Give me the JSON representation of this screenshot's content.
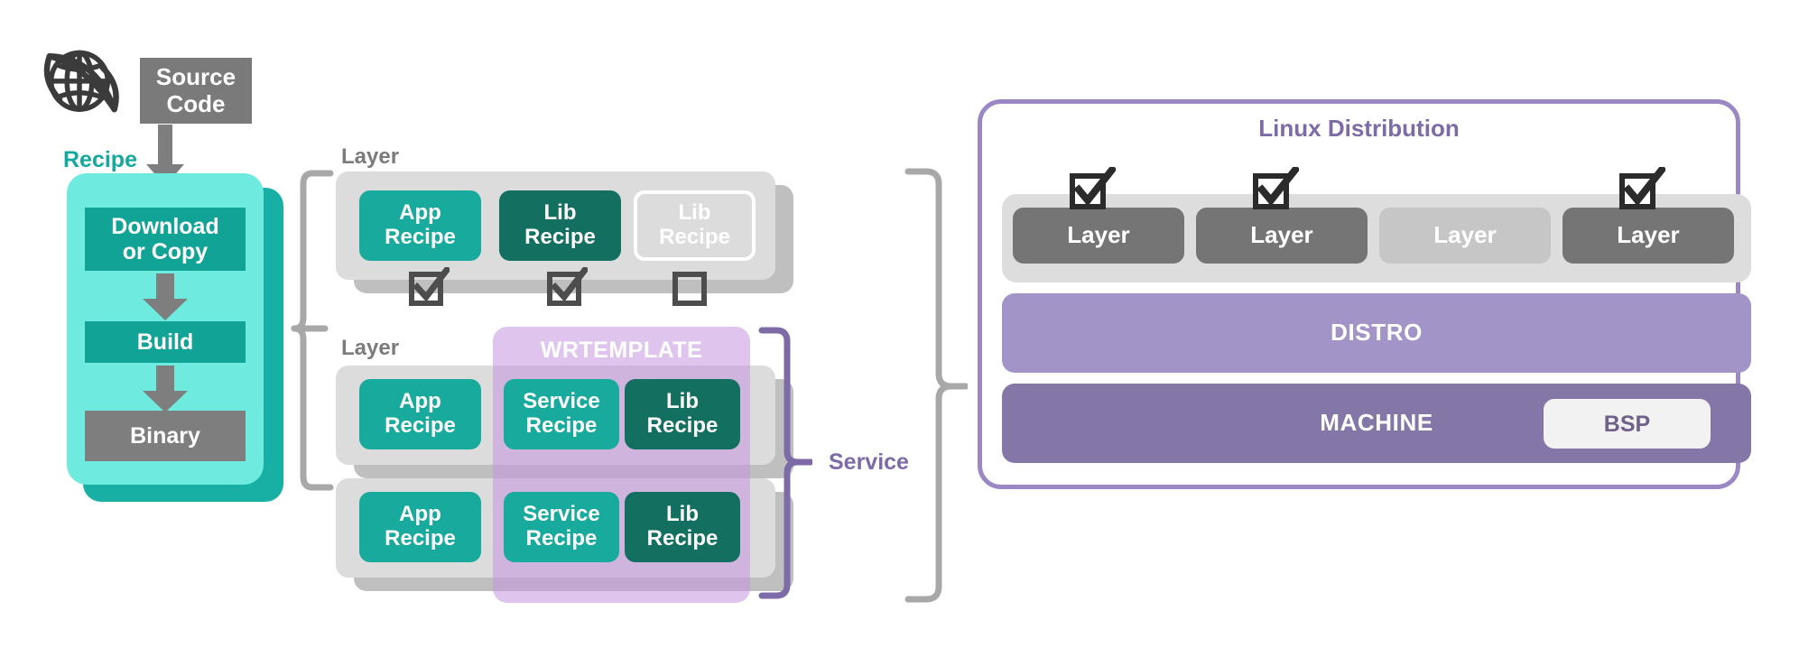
{
  "source": {
    "globe_icon": "globe-icon",
    "title": "Source\nCode",
    "title_line1": "Source",
    "title_line2": "Code"
  },
  "recipe": {
    "label": "Recipe",
    "steps": [
      {
        "label": "Download\nor Copy",
        "line1": "Download",
        "line2": "or Copy",
        "style": "teal"
      },
      {
        "label": "Build",
        "line1": "Build",
        "line2": "",
        "style": "teal"
      },
      {
        "label": "Binary",
        "line1": "Binary",
        "line2": "",
        "style": "gray"
      }
    ],
    "colors": {
      "card": "#6eeade",
      "shadow": "#18b0a4",
      "step": "#12a397",
      "step_gray": "#7e7e7e",
      "label": "#13a99d"
    }
  },
  "layers": {
    "label": "Layer",
    "group_top": {
      "label": "Layer",
      "recipes": [
        {
          "line1": "App",
          "line2": "Recipe",
          "kind": "app",
          "checkbox": "checked"
        },
        {
          "line1": "Lib",
          "line2": "Recipe",
          "kind": "lib",
          "checkbox": "checked"
        },
        {
          "line1": "Lib",
          "line2": "Recipe",
          "kind": "ghost",
          "checkbox": "unchecked"
        }
      ]
    },
    "group_mid": {
      "label": "Layer",
      "recipes": [
        {
          "line1": "App",
          "line2": "Recipe",
          "kind": "app"
        },
        {
          "line1": "Service",
          "line2": "Recipe",
          "kind": "svc"
        },
        {
          "line1": "Lib",
          "line2": "Recipe",
          "kind": "lib"
        }
      ]
    },
    "group_bottom": {
      "label": "",
      "recipes": [
        {
          "line1": "App",
          "line2": "Recipe",
          "kind": "app"
        },
        {
          "line1": "Service",
          "line2": "Recipe",
          "kind": "svc"
        },
        {
          "line1": "Lib",
          "line2": "Recipe",
          "kind": "lib"
        }
      ]
    }
  },
  "wrtemplate": {
    "title": "WRTEMPLATE",
    "color": "#c496de"
  },
  "service_bracket": {
    "label": "Service",
    "color": "#7d6ba8"
  },
  "distribution": {
    "title": "Linux Distribution",
    "border_color": "#9b87c4",
    "layer_row": [
      {
        "label": "Layer",
        "state": "on",
        "checkbox": "checked"
      },
      {
        "label": "Layer",
        "state": "on",
        "checkbox": "checked"
      },
      {
        "label": "Layer",
        "state": "off",
        "checkbox": "none"
      },
      {
        "label": "Layer",
        "state": "on",
        "checkbox": "checked"
      }
    ],
    "distro_bar": {
      "label": "DISTRO",
      "color": "#a294c6"
    },
    "machine_bar": {
      "label": "MACHINE",
      "color": "#8477a8"
    },
    "bsp": {
      "label": "BSP",
      "color": "#f2f2f2"
    }
  },
  "brackets": {
    "recipe_bracket_color": "#a8a8a8",
    "distro_bracket_color": "#a8a8a8"
  }
}
